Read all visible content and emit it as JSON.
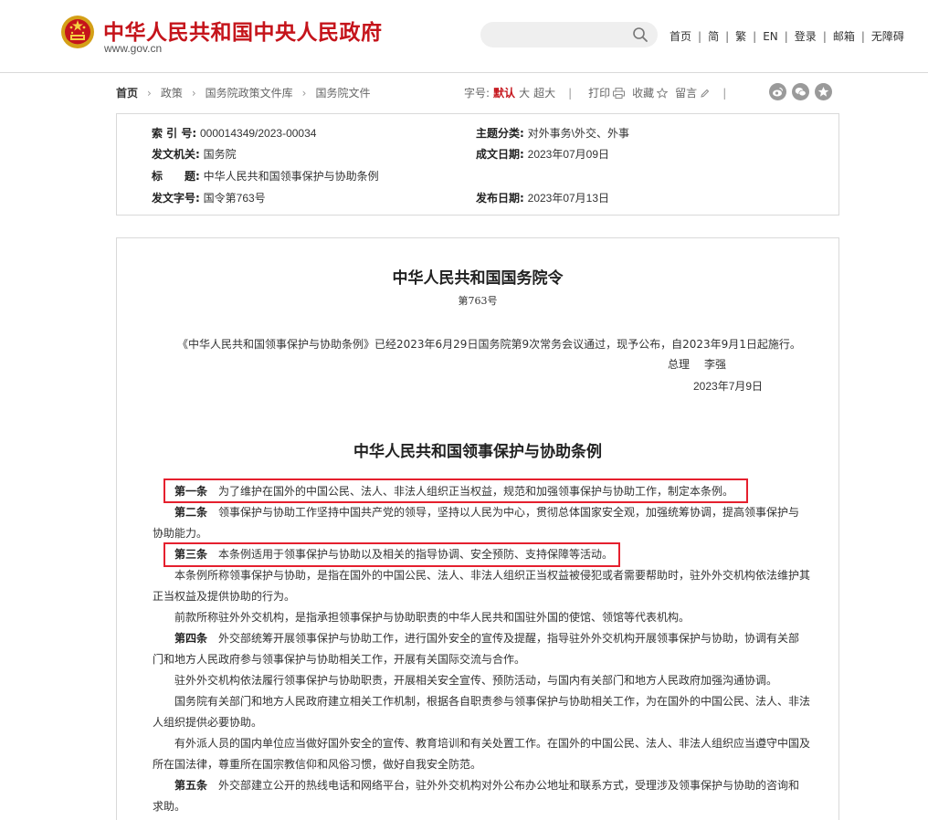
{
  "header": {
    "site_name": "中华人民共和国中央人民政府",
    "site_url": "www.gov.cn",
    "search_placeholder": "",
    "nav": [
      "首页",
      "简",
      "繁",
      "EN",
      "登录",
      "邮箱",
      "无障碍"
    ]
  },
  "breadcrumb": {
    "items": [
      "首页",
      "政策",
      "国务院政策文件库",
      "国务院文件"
    ]
  },
  "toolbar": {
    "font_size_label": "字号:",
    "font_sizes": [
      "默认",
      "大",
      "超大"
    ],
    "print": "打印",
    "favorite": "收藏",
    "comment": "留言"
  },
  "info": {
    "index_no_label": "索 引 号:",
    "index_no": "000014349/2023-00034",
    "topic_label": "主题分类:",
    "topic": "对外事务\\外交、外事",
    "issuer_label": "发文机关:",
    "issuer": "国务院",
    "written_date_label": "成文日期:",
    "written_date": "2023年07月09日",
    "title_label": "标　　题:",
    "title": "中华人民共和国领事保护与协助条例",
    "doc_no_label": "发文字号:",
    "doc_no": "国令第763号",
    "published_label": "发布日期:",
    "published": "2023年07月13日"
  },
  "article": {
    "order_title": "中华人民共和国国务院令",
    "order_no": "第763号",
    "promulgation": "《中华人民共和国领事保护与协助条例》已经2023年6月29日国务院第9次常务会议通过，现予公布，自2023年9月1日起施行。",
    "signer_title": "总理",
    "signer_name": "李强",
    "sign_date": "2023年7月9日",
    "reg_title": "中华人民共和国领事保护与协助条例",
    "paragraphs": [
      {
        "article": "第一条",
        "text": "为了维护在国外的中国公民、法人、非法人组织正当权益，规范和加强领事保护与协助工作，制定本条例。"
      },
      {
        "article": "第二条",
        "text": "领事保护与协助工作坚持中国共产党的领导，坚持以人民为中心，贯彻总体国家安全观，加强统筹协调，提高领事保护与协助能力。"
      },
      {
        "article": "第三条",
        "text": "本条例适用于领事保护与协助以及相关的指导协调、安全预防、支持保障等活动。"
      },
      {
        "article": "",
        "text": "本条例所称领事保护与协助，是指在国外的中国公民、法人、非法人组织正当权益被侵犯或者需要帮助时，驻外外交机构依法维护其正当权益及提供协助的行为。"
      },
      {
        "article": "",
        "text": "前款所称驻外外交机构，是指承担领事保护与协助职责的中华人民共和国驻外国的使馆、领馆等代表机构。"
      },
      {
        "article": "第四条",
        "text": "外交部统筹开展领事保护与协助工作，进行国外安全的宣传及提醒，指导驻外外交机构开展领事保护与协助，协调有关部门和地方人民政府参与领事保护与协助相关工作，开展有关国际交流与合作。"
      },
      {
        "article": "",
        "text": "驻外外交机构依法履行领事保护与协助职责，开展相关安全宣传、预防活动，与国内有关部门和地方人民政府加强沟通协调。"
      },
      {
        "article": "",
        "text": "国务院有关部门和地方人民政府建立相关工作机制，根据各自职责参与领事保护与协助相关工作，为在国外的中国公民、法人、非法人组织提供必要协助。"
      },
      {
        "article": "",
        "text": "有外派人员的国内单位应当做好国外安全的宣传、教育培训和有关处置工作。在国外的中国公民、法人、非法人组织应当遵守中国及所在国法律，尊重所在国宗教信仰和风俗习惯，做好自我安全防范。"
      },
      {
        "article": "第五条",
        "text": "外交部建立公开的热线电话和网络平台，驻外外交机构对外公布办公地址和联系方式，受理涉及领事保护与协助的咨询和求助。"
      }
    ]
  },
  "colors": {
    "brand_red": "#c5141b",
    "highlight_red": "#e5202e",
    "border_gray": "#d9d9d9"
  }
}
